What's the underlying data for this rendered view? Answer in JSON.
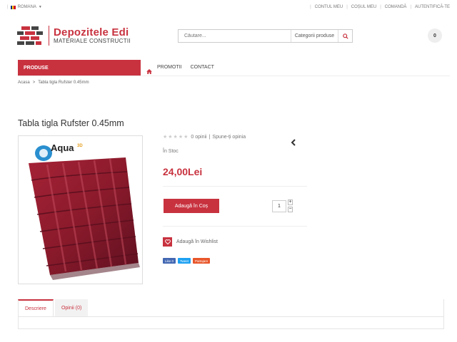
{
  "topbar": {
    "language": "ROMANA",
    "flag_colors": [
      "#002b7f",
      "#fcd116",
      "#ce1126"
    ],
    "links": [
      "CONTUL MEU",
      "COȘUL MEU",
      "COMANDĂ",
      "AUTENTIFICĂ-TE"
    ]
  },
  "logo": {
    "name": "Depozitele Edi",
    "subtitle": "MATERIALE CONSTRUCTII"
  },
  "search": {
    "placeholder": "Căutare...",
    "category": "Categorii produse",
    "icon": "search-icon"
  },
  "cart": {
    "count": "0"
  },
  "nav": {
    "produse": "PRODUSE",
    "home_icon": "home-icon",
    "links": [
      "PROMOTII",
      "CONTACT"
    ]
  },
  "breadcrumb": {
    "home": "Acasa",
    "separator": ">",
    "current": "Tabla tigla Rufster 0.45mm"
  },
  "product": {
    "title": "Tabla tigla Rufster 0.45mm",
    "image_brand": "Aqua",
    "image_brand_suffix": "3D",
    "reviews": "0 opinii",
    "review_separator": "|",
    "write_review": "Spune-ți opinia",
    "stock": "În Stoc",
    "price": "24,00Lei",
    "add_to_cart": "Adaugă în Coș",
    "quantity": "1",
    "qty_plus": "+",
    "qty_minus": "−",
    "wishlist": "Adaugă în Wishlist"
  },
  "social": {
    "like": "Like 0",
    "tweet": "Tweet",
    "share": "Partajare"
  },
  "tabs": [
    "Descriere",
    "Opinii (0)"
  ],
  "colors": {
    "accent": "#c8323f",
    "roof_tile": "#8e1a2c"
  }
}
